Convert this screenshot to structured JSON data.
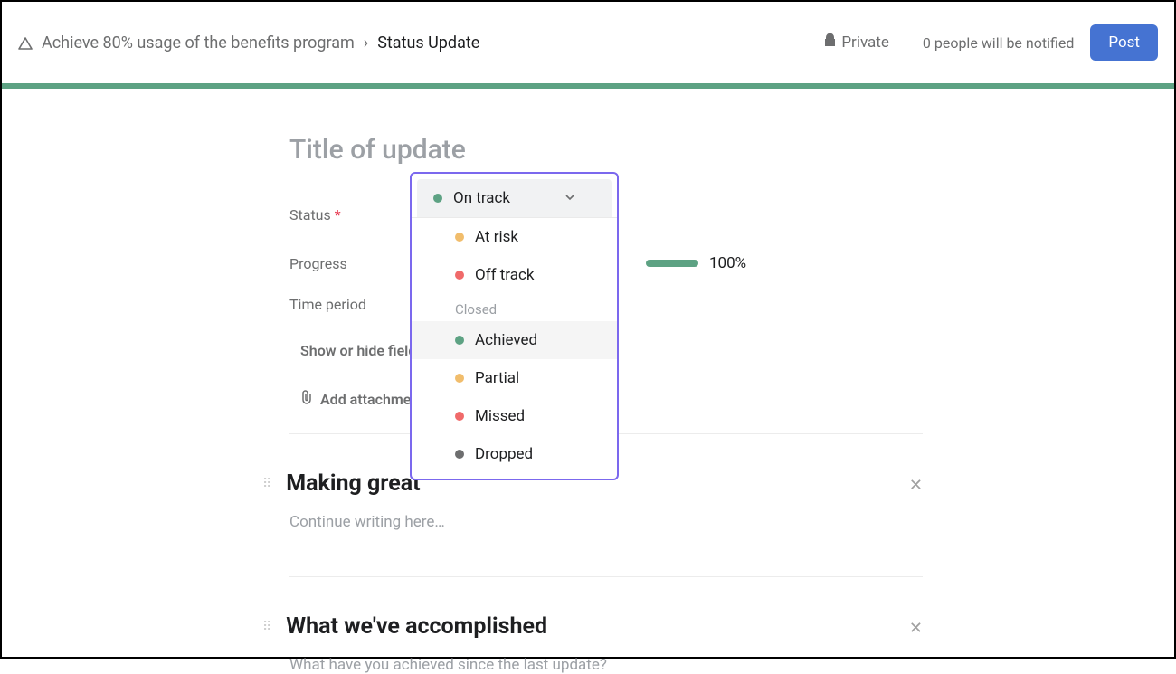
{
  "header": {
    "breadcrumb_parent": "Achieve 80% usage of the benefits program",
    "breadcrumb_current": "Status Update",
    "privacy_label": "Private",
    "notify_text": "0 people will be notified",
    "post_label": "Post"
  },
  "title_placeholder": "Title of update",
  "fields": {
    "status_label": "Status",
    "progress_label": "Progress",
    "time_period_label": "Time period",
    "show_hide_label": "Show or hide field",
    "add_attachment_label": "Add attachment"
  },
  "status": {
    "selected": "On track",
    "options_open": [
      {
        "label": "At risk",
        "color": "amber"
      },
      {
        "label": "Off track",
        "color": "red"
      }
    ],
    "closed_group_label": "Closed",
    "options_closed": [
      {
        "label": "Achieved",
        "color": "green",
        "highlight": true
      },
      {
        "label": "Partial",
        "color": "amber"
      },
      {
        "label": "Missed",
        "color": "red"
      },
      {
        "label": "Dropped",
        "color": "gray"
      }
    ]
  },
  "progress_pct": "100%",
  "sections": [
    {
      "title": "Making great",
      "placeholder": "Continue writing here…"
    },
    {
      "title": "What we've accomplished",
      "placeholder": "What have you achieved since the last update?"
    }
  ]
}
